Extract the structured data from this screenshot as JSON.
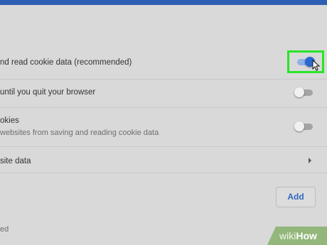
{
  "settings": {
    "rows": [
      {
        "label": "nd read cookie data (recommended)",
        "toggle_on": true
      },
      {
        "label": " until you quit your browser",
        "toggle_on": false
      },
      {
        "label": "okies",
        "sublabel": "websites from saving and reading cookie data",
        "toggle_on": false
      },
      {
        "label": "site data"
      }
    ],
    "add_button_label": "Add",
    "bottom_partial_text": "ed"
  },
  "icons": {
    "cursor": "cursor-icon",
    "chevron": "chevron-right-icon"
  },
  "colors": {
    "accent": "#2a68d0",
    "toggle_track_on": "#8fb0e6",
    "highlight": "#26e626",
    "top_bar": "#2f5fb5",
    "watermark_bg": "#93b77a"
  },
  "watermark": {
    "wiki": "wiki",
    "how": "How"
  }
}
